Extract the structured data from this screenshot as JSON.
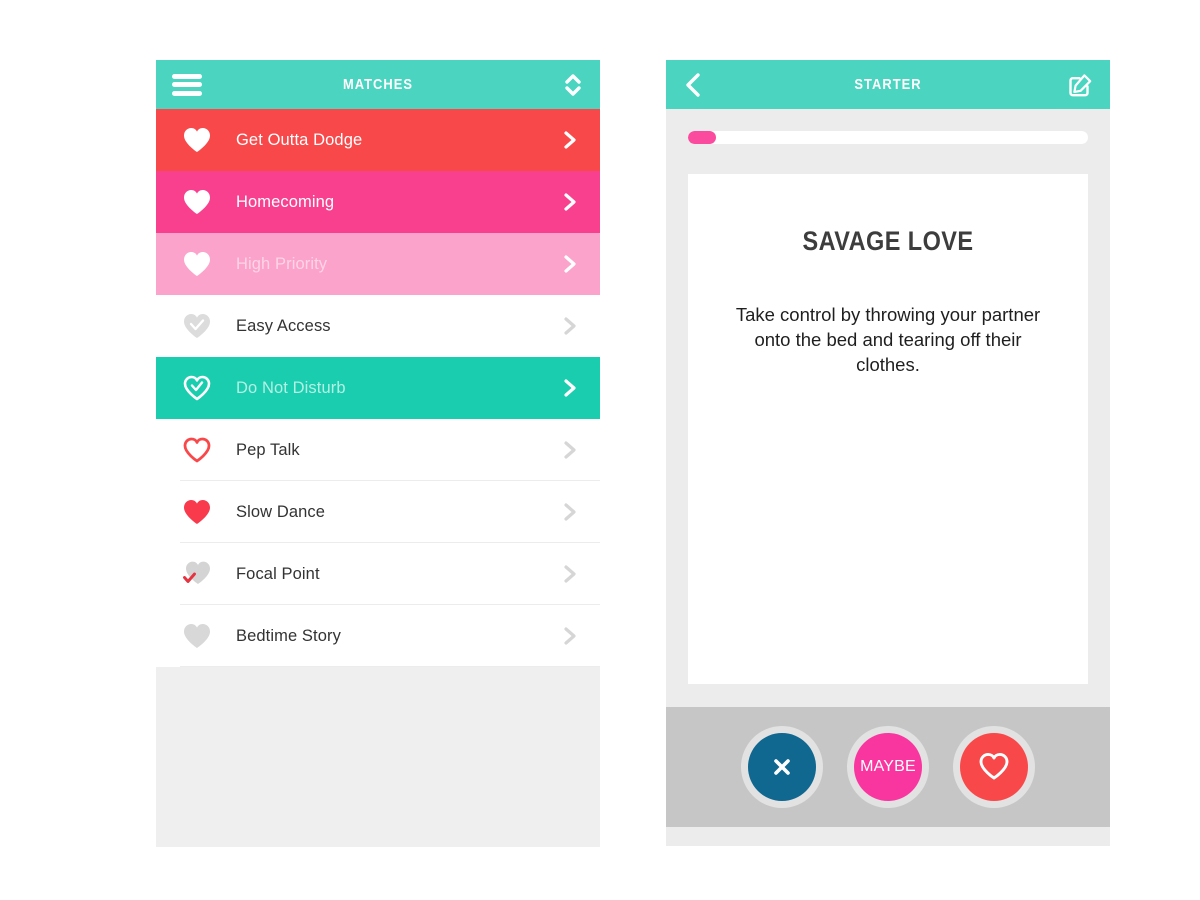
{
  "matches_panel": {
    "header": {
      "title": "MATCHES",
      "menu_icon": "hamburger-icon",
      "sort_icon": "sort-updown-icon"
    },
    "rows": [
      {
        "label": "Get Outta Dodge",
        "heart": "solid-white-heart",
        "bg": "#f9484a",
        "text_color": "#ffffff",
        "chevron_color": "#ffffff"
      },
      {
        "label": "Homecoming",
        "heart": "solid-white-heart",
        "bg": "#f9408f",
        "text_color": "#ffffff",
        "chevron_color": "#ffffff"
      },
      {
        "label": "High Priority",
        "heart": "solid-white-heart",
        "bg": "#fba3ca",
        "text_color": "#ffd4e6",
        "chevron_color": "#ffffff"
      },
      {
        "label": "Easy Access",
        "heart": "gray-heart-check-icon",
        "bg": "#ffffff",
        "text_color": "#333333",
        "chevron_color": "#d6d6d6"
      },
      {
        "label": "Do Not Disturb",
        "heart": "outline-white-heart-check",
        "bg": "#19cdae",
        "text_color": "#b3f0e5",
        "chevron_color": "#ffffff"
      },
      {
        "label": "Pep Talk",
        "heart": "outline-red-heart",
        "bg": "#ffffff",
        "text_color": "#333333",
        "chevron_color": "#d6d6d6"
      },
      {
        "label": "Slow Dance",
        "heart": "solid-red-heart",
        "bg": "#ffffff",
        "text_color": "#333333",
        "chevron_color": "#d6d6d6"
      },
      {
        "label": "Focal Point",
        "heart": "gray-heart-red-check",
        "bg": "#ffffff",
        "text_color": "#333333",
        "chevron_color": "#d6d6d6"
      },
      {
        "label": "Bedtime Story",
        "heart": "solid-gray-heart",
        "bg": "#ffffff",
        "text_color": "#333333",
        "chevron_color": "#d6d6d6"
      }
    ]
  },
  "starter_panel": {
    "header": {
      "title": "STARTER",
      "back_icon": "back-chevron-icon",
      "compose_icon": "compose-pencil-icon"
    },
    "progress": {
      "percent": 7
    },
    "card": {
      "title": "SAVAGE LOVE",
      "body": "Take control by throwing your partner onto the bed and tearing off their clothes."
    },
    "actions": [
      {
        "name": "reject",
        "label": "",
        "icon": "close-x-icon",
        "color": "#10678f"
      },
      {
        "name": "maybe",
        "label": "MAYBE",
        "icon": "",
        "color": "#f9359f"
      },
      {
        "name": "like",
        "label": "",
        "icon": "outline-heart-icon",
        "color": "#f9484a"
      }
    ]
  },
  "theme": {
    "teal": "#4bd5c0",
    "teal_row": "#19cdae",
    "red": "#f9484a",
    "pink": "#f9408f",
    "light_pink": "#fba3ca",
    "page_bg": "#ececec",
    "footer_gray": "#c6c6c6"
  }
}
